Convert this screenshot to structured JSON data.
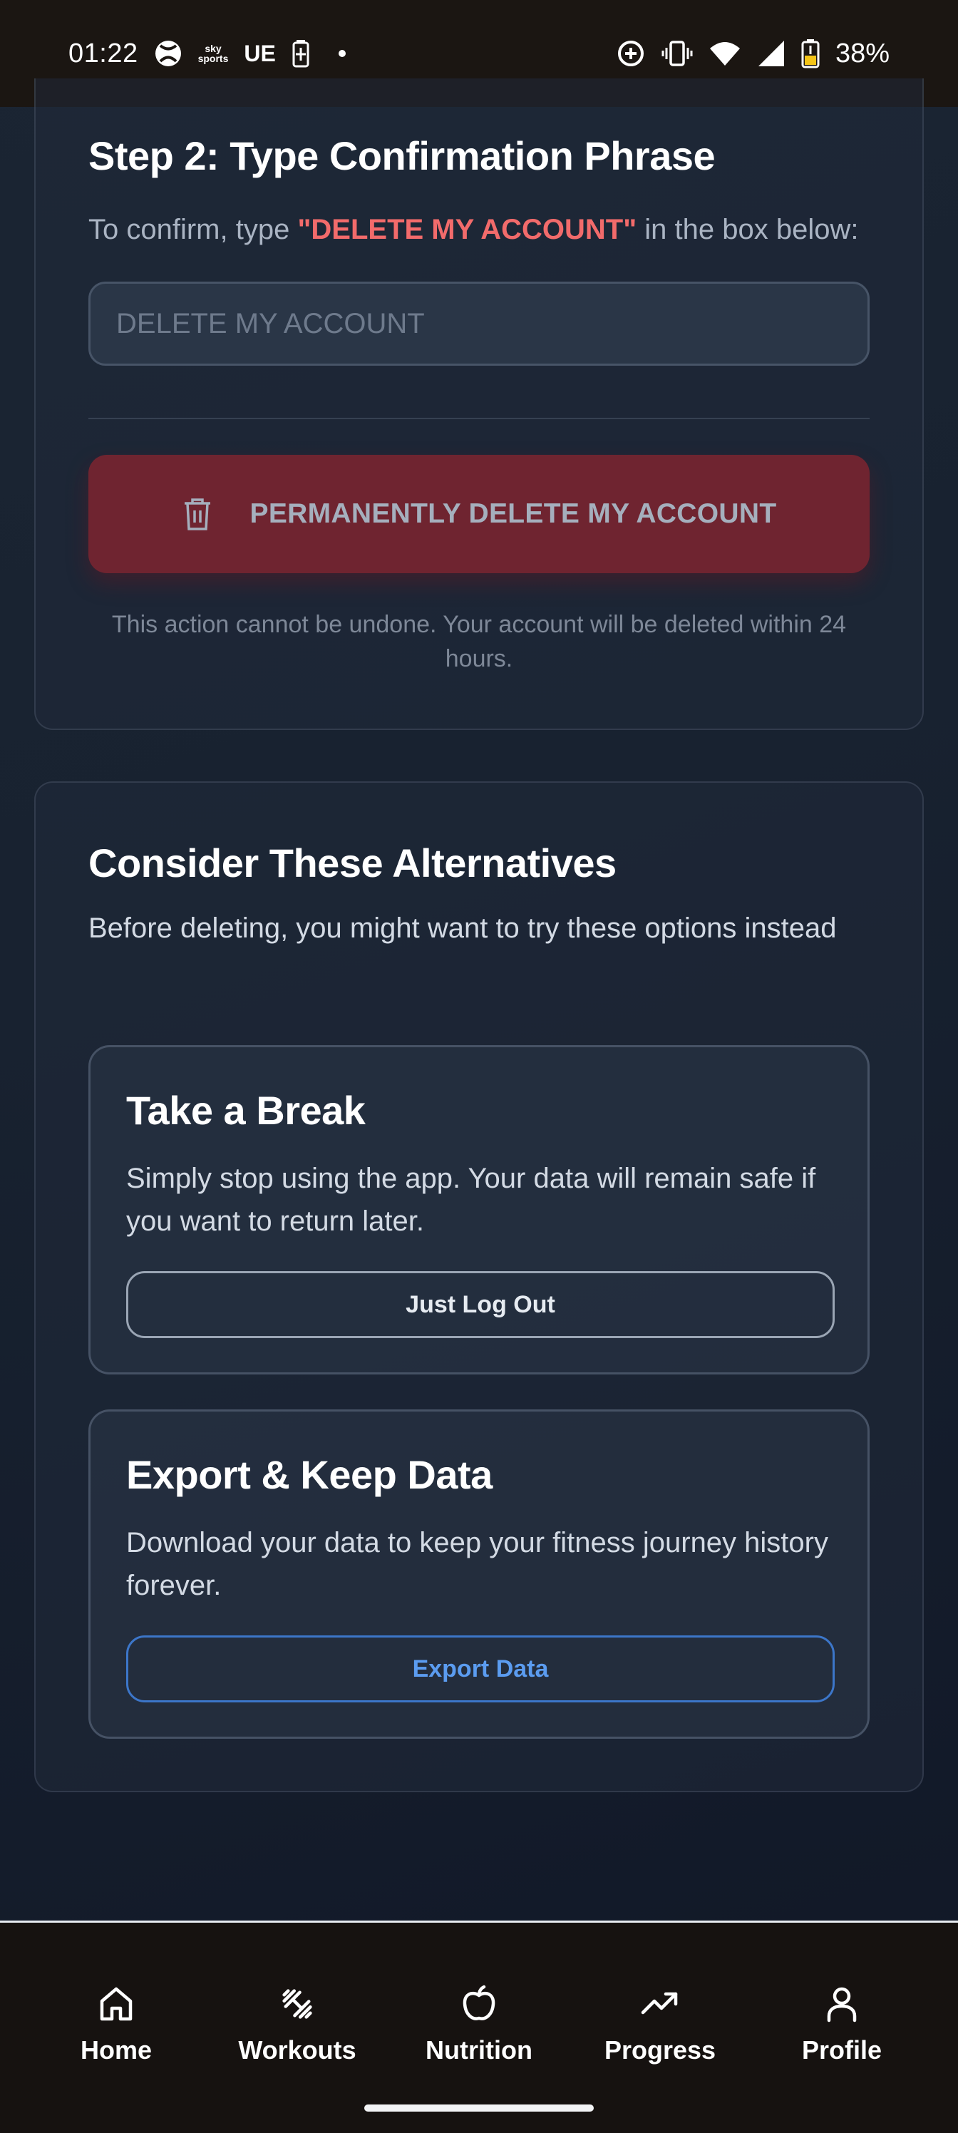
{
  "status_bar": {
    "time": "01:22",
    "sky_sports_line1": "sky",
    "sky_sports_line2": "sports",
    "ue_label": "UE",
    "battery": "38%",
    "icons": [
      "xbox-icon",
      "sky-sports-icon",
      "battery-saver-icon",
      "dot-icon",
      "data-saver-icon",
      "vibrate-icon",
      "wifi-icon",
      "signal-icon",
      "battery-icon"
    ]
  },
  "step2": {
    "title": "Step 2: Type Confirmation Phrase",
    "confirm_prefix": "To confirm, type ",
    "confirm_phrase": "\"DELETE MY ACCOUNT\"",
    "confirm_suffix": " in the box below:",
    "input_placeholder": "DELETE MY ACCOUNT",
    "input_value": "",
    "delete_button_label": "PERMANENTLY DELETE MY ACCOUNT",
    "delete_button_icon": "trash-icon",
    "warning_note": "This action cannot be undone. Your account will be deleted within 24 hours."
  },
  "alternatives": {
    "title": "Consider These Alternatives",
    "subtitle": "Before deleting, you might want to try these options instead",
    "options": [
      {
        "title": "Take a Break",
        "description": "Simply stop using the app. Your data will remain safe if you want to return later.",
        "button_label": "Just Log Out"
      },
      {
        "title": "Export & Keep Data",
        "description": "Download your data to keep your fitness journey history forever.",
        "button_label": "Export Data"
      }
    ]
  },
  "bottom_nav": {
    "items": [
      {
        "label": "Home",
        "icon": "home-icon"
      },
      {
        "label": "Workouts",
        "icon": "dumbbell-icon"
      },
      {
        "label": "Nutrition",
        "icon": "apple-icon"
      },
      {
        "label": "Progress",
        "icon": "trending-up-icon"
      },
      {
        "label": "Profile",
        "icon": "user-icon"
      }
    ]
  },
  "colors": {
    "accent_red": "#f26b6b",
    "delete_button_bg": "#6f2430",
    "export_blue": "#5b9cf0",
    "background": "#182230"
  }
}
